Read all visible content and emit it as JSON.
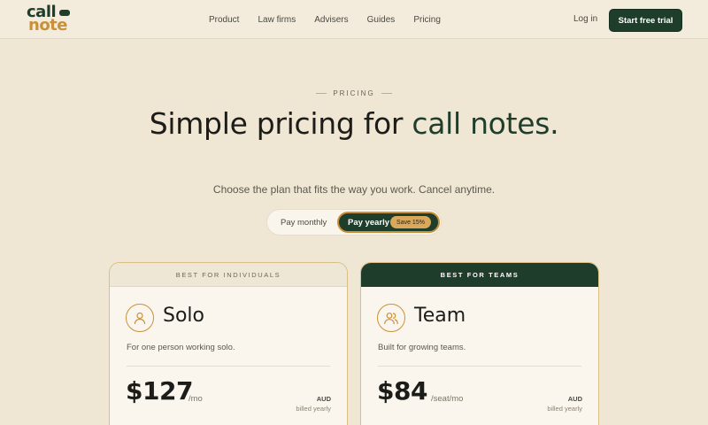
{
  "brand": {
    "logo_line1": "call",
    "logo_line2": "note",
    "colors": {
      "primary": "#1f3d2b",
      "accent": "#c9903a",
      "background": "#efe6d4"
    }
  },
  "nav": {
    "items": [
      "Product",
      "Law firms",
      "Advisers",
      "Guides",
      "Pricing"
    ],
    "login": "Log in",
    "cta": "Start free trial"
  },
  "hero": {
    "eyebrow": "PRICING",
    "title_part1": "Simple pricing for ",
    "title_accent": "call notes.",
    "subtitle": "Choose the plan that fits the way you work. Cancel anytime."
  },
  "billing_toggle": {
    "monthly": "Pay monthly",
    "yearly": "Pay yearly",
    "badge": "Save 15%",
    "selected": "yearly"
  },
  "plans": [
    {
      "banner": "BEST FOR INDIVIDUALS",
      "icon": "person-icon",
      "name": "Solo",
      "description": "For one person working solo.",
      "price": "$127",
      "period": "/mo",
      "currency": "AUD",
      "billed": "billed yearly"
    },
    {
      "banner": "BEST FOR TEAMS",
      "icon": "people-icon",
      "name": "Team",
      "description": "Built for growing teams.",
      "price": "$84",
      "period": "/seat/mo",
      "currency": "AUD",
      "billed": "billed yearly"
    }
  ]
}
